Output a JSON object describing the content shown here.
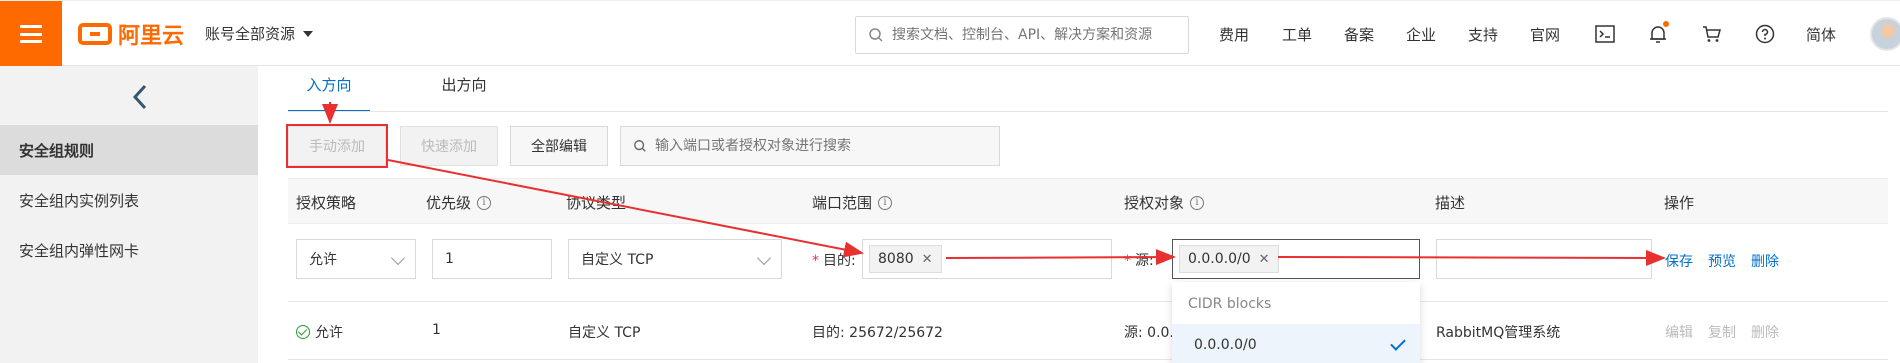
{
  "topbar": {
    "logo_text": "阿里云",
    "account_label": "账号全部资源",
    "search_placeholder": "搜索文档、控制台、API、解决方案和资源",
    "nav": [
      "费用",
      "工单",
      "备案",
      "企业",
      "支持",
      "官网"
    ],
    "lang": "简体",
    "icons": [
      "terminal-icon",
      "bell-icon",
      "cart-icon",
      "help-icon"
    ],
    "accent_color": "#ff6a00"
  },
  "sidebar": {
    "items": [
      {
        "label": "安全组规则",
        "active": true
      },
      {
        "label": "安全组内实例列表",
        "active": false
      },
      {
        "label": "安全组内弹性网卡",
        "active": false
      }
    ]
  },
  "tabs": [
    {
      "label": "入方向",
      "active": true
    },
    {
      "label": "出方向",
      "active": false
    }
  ],
  "toolbar": {
    "manual_add": "手动添加",
    "quick_add": "快速添加",
    "edit_all": "全部编辑",
    "search_placeholder": "输入端口或者授权对象进行搜索"
  },
  "table": {
    "headers": [
      "授权策略",
      "优先级",
      "协议类型",
      "端口范围",
      "授权对象",
      "描述",
      "操作"
    ],
    "edit_row": {
      "policy": "允许",
      "priority": "1",
      "protocol": "自定义 TCP",
      "port_prefix": "目的:",
      "port_tag": "8080",
      "source_prefix": "源:",
      "source_tag": "0.0.0.0/0",
      "description": "",
      "actions": [
        "保存",
        "预览",
        "删除"
      ]
    },
    "rows": [
      {
        "policy": "允许",
        "priority": "1",
        "protocol": "自定义 TCP",
        "port": "目的: 25672/25672",
        "source": "源: 0.0.",
        "description": "RabbitMQ管理系统",
        "actions": [
          "编辑",
          "复制",
          "删除"
        ]
      }
    ]
  },
  "dropdown": {
    "header": "CIDR blocks",
    "option": "0.0.0.0/0"
  },
  "link_color": "#0070cc",
  "annotation_color": "#e83030"
}
